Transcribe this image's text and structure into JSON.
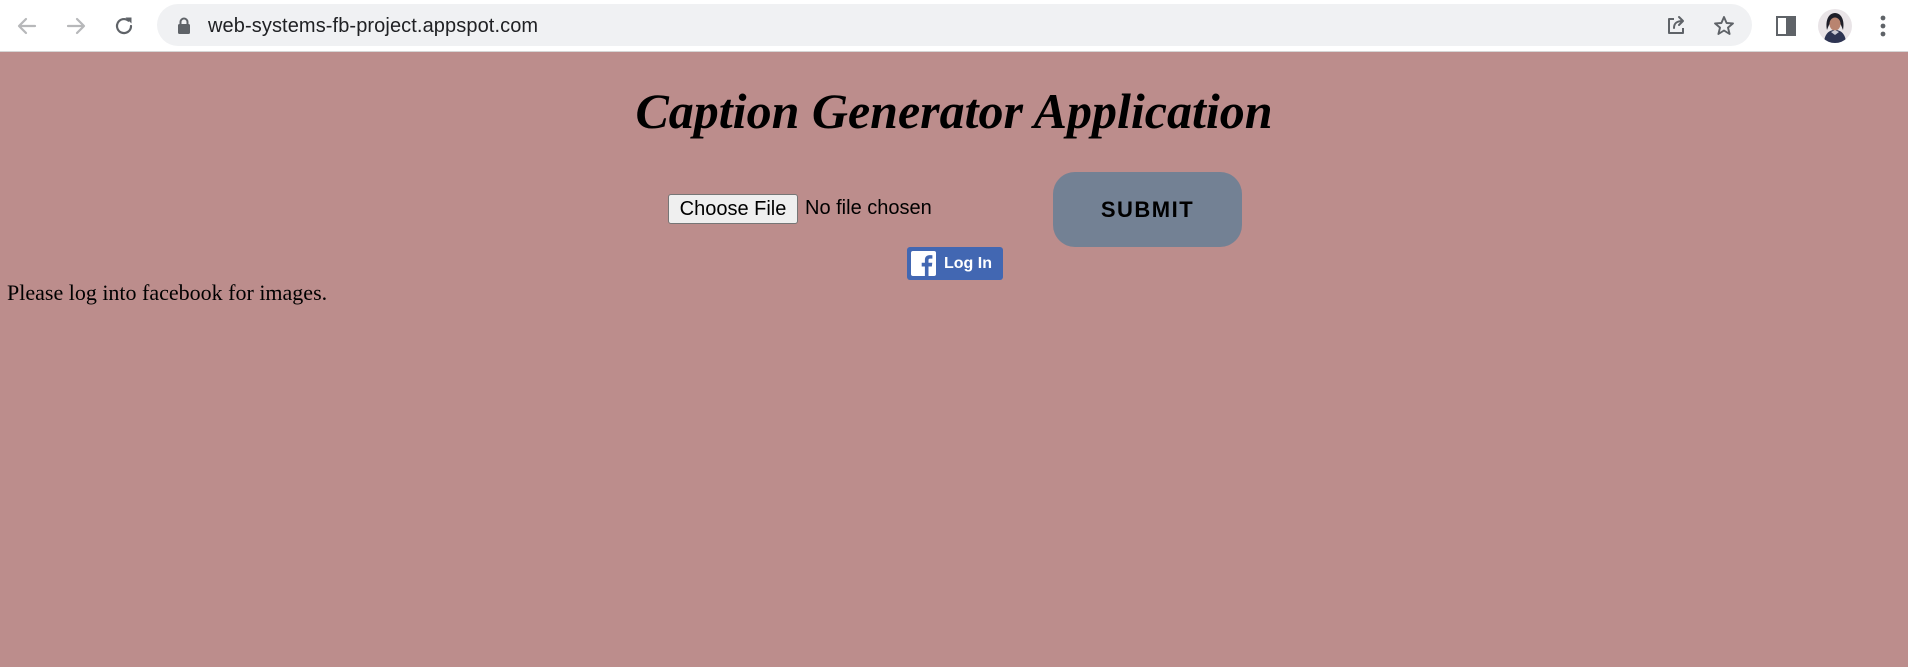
{
  "browser": {
    "url": "web-systems-fb-project.appspot.com",
    "icons": {
      "back": "arrow-left-icon",
      "forward": "arrow-right-icon",
      "reload": "reload-icon",
      "lock": "lock-icon",
      "share": "share-icon",
      "bookmark": "star-icon",
      "side_panel": "side-panel-icon",
      "menu": "kebab-menu-icon"
    }
  },
  "page": {
    "background_color": "#bc8d8c",
    "title": "Caption Generator Application",
    "file_input": {
      "button_label": "Choose File",
      "status": "No file chosen"
    },
    "submit": {
      "label": "SUBMIT",
      "color": "#738194"
    },
    "facebook_login": {
      "label": "Log In",
      "color": "#4267b2"
    },
    "message": "Please log into facebook for images."
  }
}
